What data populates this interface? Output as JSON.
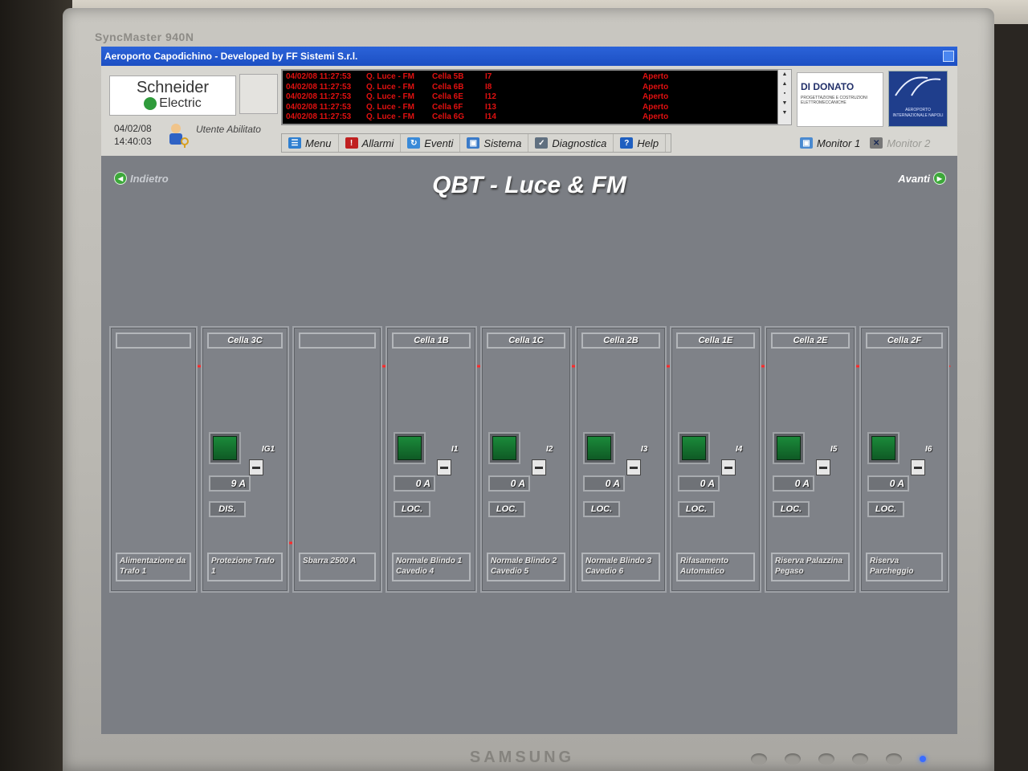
{
  "monitor": {
    "model": "SyncMaster 940N",
    "brand": "SAMSUNG"
  },
  "window": {
    "title": "Aeroporto Capodichino - Developed by FF Sistemi S.r.l."
  },
  "header": {
    "logo_line1": "Schneider",
    "logo_line2": "Electric",
    "date": "04/02/08",
    "time": "14:40:03",
    "user_label": "Utente Abilitato",
    "events": [
      {
        "ts": "04/02/08 11:27:53",
        "device": "Q. Luce - FM",
        "cell": "Cella 5B",
        "id": "I7",
        "status": "Aperto"
      },
      {
        "ts": "04/02/08 11:27:53",
        "device": "Q. Luce - FM",
        "cell": "Cella 6B",
        "id": "I8",
        "status": "Aperto"
      },
      {
        "ts": "04/02/08 11:27:53",
        "device": "Q. Luce - FM",
        "cell": "Cella 6E",
        "id": "I12",
        "status": "Aperto"
      },
      {
        "ts": "04/02/08 11:27:53",
        "device": "Q. Luce - FM",
        "cell": "Cella 6F",
        "id": "I13",
        "status": "Aperto"
      },
      {
        "ts": "04/02/08 11:27:53",
        "device": "Q. Luce - FM",
        "cell": "Cella 6G",
        "id": "I14",
        "status": "Aperto"
      }
    ],
    "partner_name": "DI DONATO",
    "partner_sub": "PROGETTAZIONE E COSTRUZIONI ELETTROMECCANICHE",
    "airport_text": "AEROPORTO INTERNAZIONALE NAPOLI"
  },
  "menu": {
    "items": [
      {
        "label": "Menu",
        "icon": "menu-icon",
        "color": "#2f7fd0"
      },
      {
        "label": "Allarmi",
        "icon": "alarm-icon",
        "color": "#c02020"
      },
      {
        "label": "Eventi",
        "icon": "events-icon",
        "color": "#3a8ad8"
      },
      {
        "label": "Sistema",
        "icon": "system-icon",
        "color": "#3a7ac8"
      },
      {
        "label": "Diagnostica",
        "icon": "diagnostic-icon",
        "color": "#607080"
      },
      {
        "label": "Help",
        "icon": "help-icon",
        "color": "#1f5fc0"
      }
    ],
    "monitor1": "Monitor 1",
    "monitor2": "Monitor 2"
  },
  "page": {
    "title": "QBT - Luce & FM",
    "back": "Indietro",
    "forward": "Avanti"
  },
  "cells": [
    {
      "header": "",
      "footer": "Alimentazione da Trafo 1"
    },
    {
      "header": "Cella 3C",
      "footer": "Protezione Trafo 1",
      "breaker": "IG1",
      "amps": "9 A",
      "mode": "DIS."
    },
    {
      "header": "",
      "footer": "Sbarra 2500 A"
    },
    {
      "header": "Cella 1B",
      "footer": "Normale Blindo 1 Cavedio 4",
      "breaker": "I1",
      "amps": "0 A",
      "mode": "LOC."
    },
    {
      "header": "Cella 1C",
      "footer": "Normale Blindo 2 Cavedio 5",
      "breaker": "I2",
      "amps": "0 A",
      "mode": "LOC."
    },
    {
      "header": "Cella 2B",
      "footer": "Normale Blindo 3 Cavedio 6",
      "breaker": "I3",
      "amps": "0 A",
      "mode": "LOC."
    },
    {
      "header": "Cella 1E",
      "footer": "Rifasamento Automatico",
      "breaker": "I4",
      "amps": "0 A",
      "mode": "LOC."
    },
    {
      "header": "Cella 2E",
      "footer": "Riserva Palazzina Pegaso",
      "breaker": "I5",
      "amps": "0 A",
      "mode": "LOC."
    },
    {
      "header": "Cella 2F",
      "footer": "Riserva Parcheggio",
      "breaker": "I6",
      "amps": "0 A",
      "mode": "LOC."
    }
  ],
  "colors": {
    "energized": "#ff2a2a",
    "deenergized": "#e8e8e8",
    "background": "#7b7e84"
  }
}
